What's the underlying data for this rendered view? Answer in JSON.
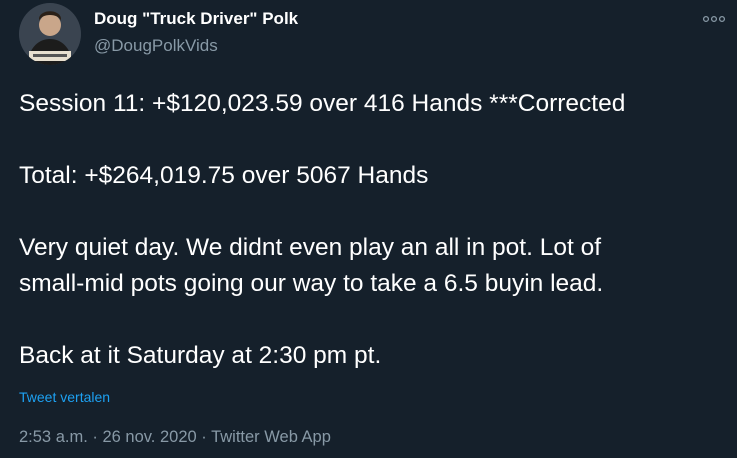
{
  "author": {
    "name": "Doug \"Truck Driver\" Polk",
    "handle": "@DougPolkVids",
    "avatar_icon": "profile-photo"
  },
  "more_icon": "more-horizontal-icon",
  "tweet": {
    "paragraphs": [
      {
        "lines": [
          "Session 11: +$120,023.59 over 416 Hands ***Corrected"
        ]
      },
      {
        "lines": [
          "Total: +$264,019.75 over 5067 Hands"
        ]
      },
      {
        "lines": [
          "Very quiet day. We didnt even play an all in pot. Lot of",
          "small-mid pots going our way to take a 6.5 buyin lead."
        ]
      },
      {
        "lines": [
          "Back at it Saturday at 2:30 pm pt."
        ]
      }
    ],
    "translate_label": "Tweet vertalen"
  },
  "meta": {
    "time": "2:53 a.m.",
    "separator": "·",
    "date": "26 nov. 2020",
    "source": "Twitter Web App"
  },
  "colors": {
    "background": "#15202b",
    "text_primary": "#ffffff",
    "text_secondary": "#8899a6",
    "link": "#1da1f2"
  }
}
